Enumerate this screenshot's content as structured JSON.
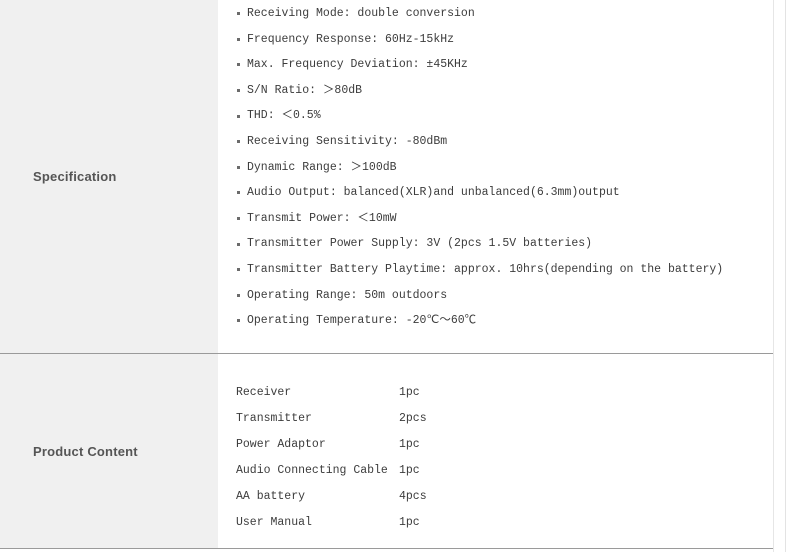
{
  "sections": [
    {
      "label": "Specification",
      "type": "bullets",
      "items": [
        "Receiving Mode: double conversion",
        "Frequency Response: 60Hz-15kHz",
        "Max. Frequency Deviation: ±45KHz",
        "S/N Ratio: ＞80dB",
        "THD: ＜0.5%",
        "Receiving Sensitivity: -80dBm",
        "Dynamic Range: ＞100dB",
        "Audio Output: balanced(XLR)and unbalanced(6.3mm)output",
        "Transmit Power: ＜10mW",
        "Transmitter Power Supply: 3V (2pcs 1.5V batteries)",
        "Transmitter Battery Playtime: approx. 10hrs(depending on the battery)",
        "Operating Range: 50m outdoors",
        "Operating Temperature: -20℃〜60℃"
      ]
    },
    {
      "label": "Product Content",
      "type": "pairs",
      "items": [
        {
          "name": "Receiver",
          "qty": "1pc"
        },
        {
          "name": "Transmitter",
          "qty": "2pcs"
        },
        {
          "name": "Power Adaptor",
          "qty": "1pc"
        },
        {
          "name": "Audio Connecting Cable",
          "qty": "1pc"
        },
        {
          "name": "AA battery",
          "qty": "4pcs"
        },
        {
          "name": "User Manual",
          "qty": "1pc"
        }
      ]
    }
  ],
  "colors": {
    "label_background": "#f0f0f0",
    "divider": "#9a9a9a",
    "text": "#3c3c3c",
    "label_text": "#555555"
  }
}
